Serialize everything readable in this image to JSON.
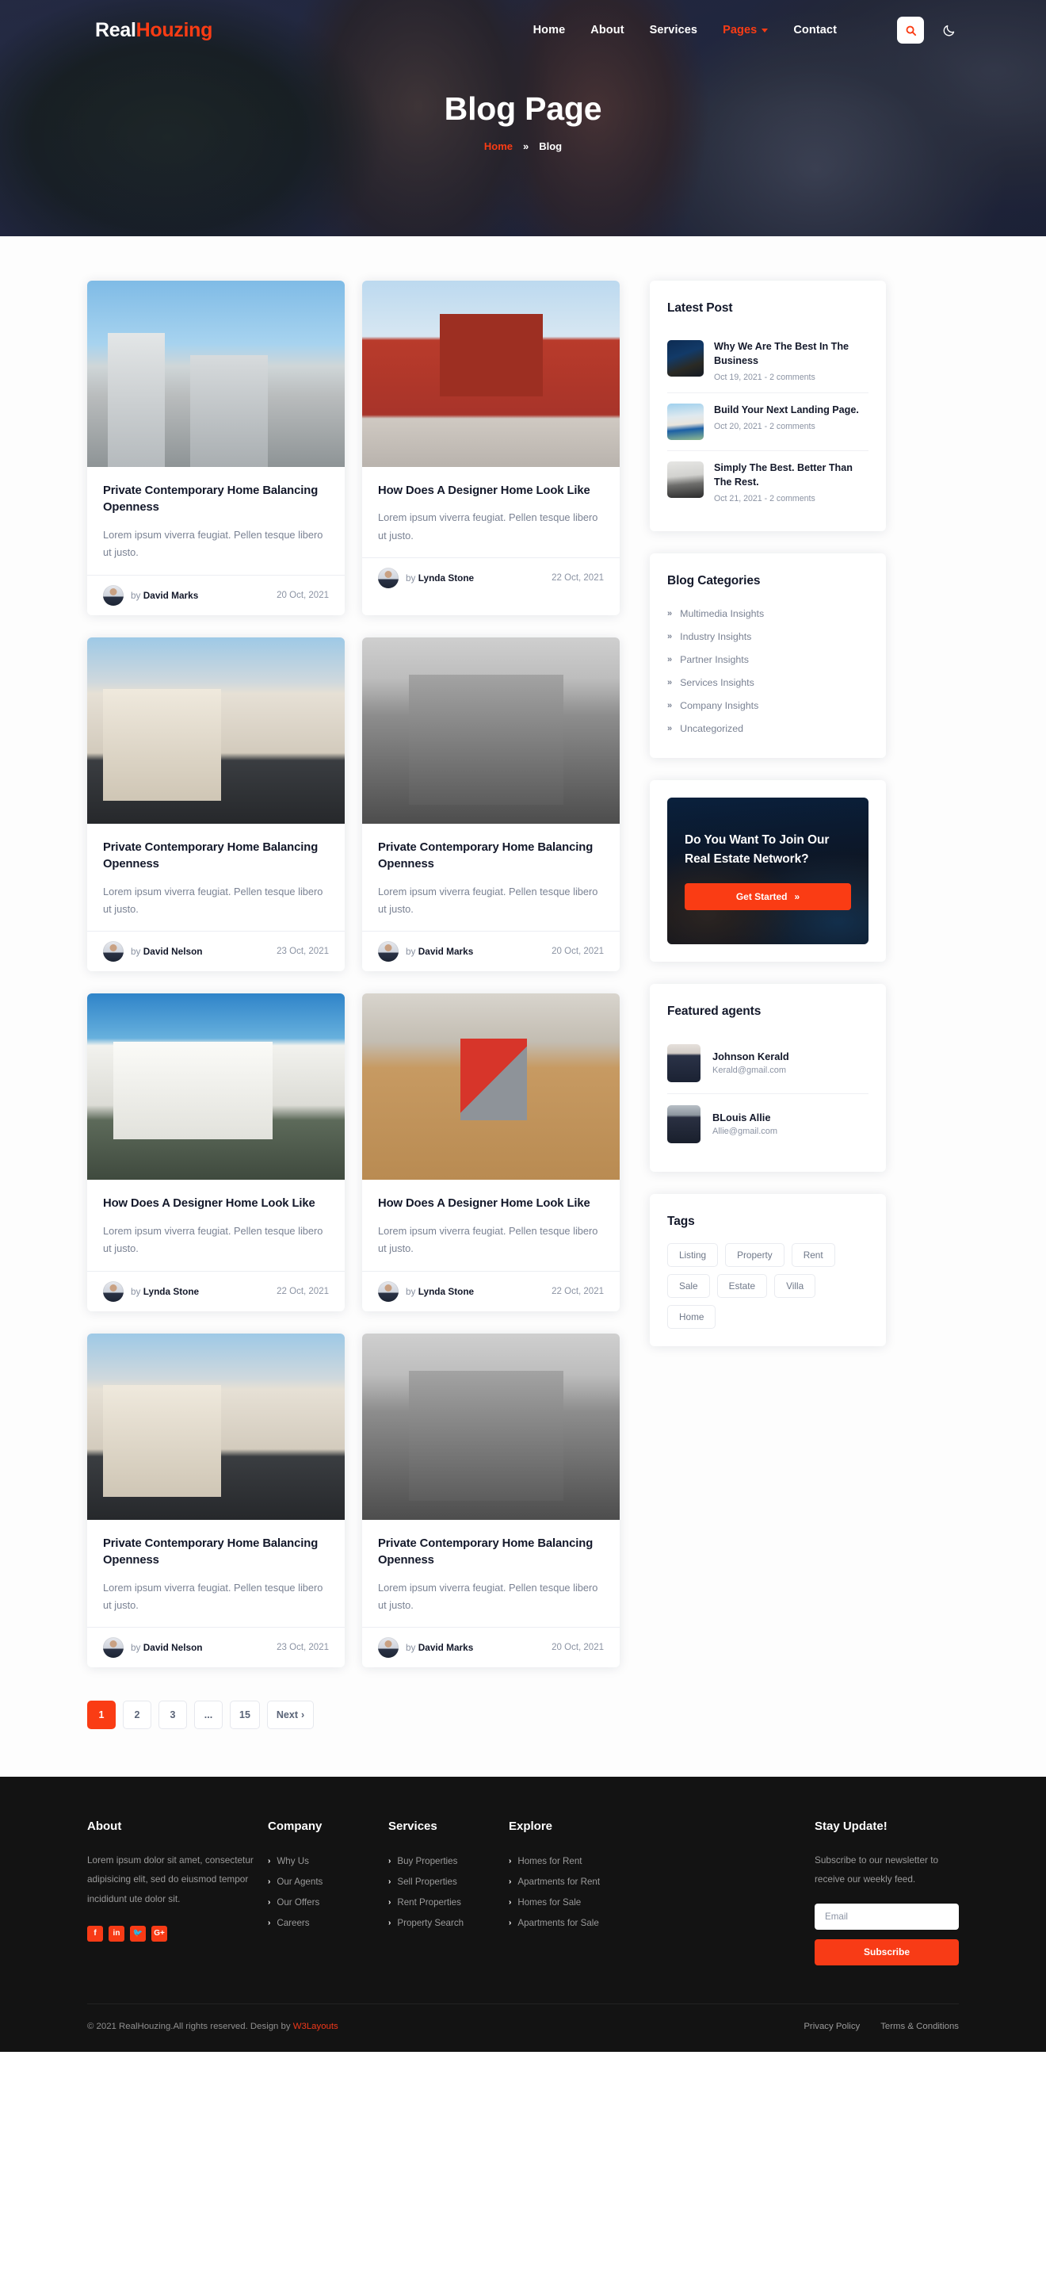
{
  "brand": {
    "part1": "Real",
    "part2": "Houzing"
  },
  "nav": {
    "links": [
      {
        "label": "Home",
        "active": false
      },
      {
        "label": "About",
        "active": false
      },
      {
        "label": "Services",
        "active": false
      },
      {
        "label": "Pages",
        "active": true
      },
      {
        "label": "Contact",
        "active": false
      }
    ],
    "search_icon": "search-icon",
    "theme_icon": "moon-icon"
  },
  "hero": {
    "title": "Blog Page",
    "breadcrumb_home": "Home",
    "breadcrumb_sep": "»",
    "breadcrumb_current": "Blog"
  },
  "posts": [
    {
      "title": "Private Contemporary Home Balancing Openness",
      "excerpt": "Lorem ipsum viverra feugiat. Pellen tesque libero ut justo.",
      "by": "by",
      "author": "David Marks",
      "date": "20 Oct, 2021",
      "img": "im-city1"
    },
    {
      "title": "How Does A Designer Home Look Like",
      "excerpt": "Lorem ipsum viverra feugiat. Pellen tesque libero ut justo.",
      "by": "by",
      "author": "Lynda Stone",
      "date": "22 Oct, 2021",
      "img": "im-red"
    },
    {
      "title": "Private Contemporary Home Balancing Openness",
      "excerpt": "Lorem ipsum viverra feugiat. Pellen tesque libero ut justo.",
      "by": "by",
      "author": "David Nelson",
      "date": "23 Oct, 2021",
      "img": "im-beige"
    },
    {
      "title": "Private Contemporary Home Balancing Openness",
      "excerpt": "Lorem ipsum viverra feugiat. Pellen tesque libero ut justo.",
      "by": "by",
      "author": "David Marks",
      "date": "20 Oct, 2021",
      "img": "im-gray"
    },
    {
      "title": "How Does A Designer Home Look Like",
      "excerpt": "Lorem ipsum viverra feugiat. Pellen tesque libero ut justo.",
      "by": "by",
      "author": "Lynda Stone",
      "date": "22 Oct, 2021",
      "img": "im-white"
    },
    {
      "title": "How Does A Designer Home Look Like",
      "excerpt": "Lorem ipsum viverra feugiat. Pellen tesque libero ut justo.",
      "by": "by",
      "author": "Lynda Stone",
      "date": "22 Oct, 2021",
      "img": "im-key"
    },
    {
      "title": "Private Contemporary Home Balancing Openness",
      "excerpt": "Lorem ipsum viverra feugiat. Pellen tesque libero ut justo.",
      "by": "by",
      "author": "David Nelson",
      "date": "23 Oct, 2021",
      "img": "im-beige"
    },
    {
      "title": "Private Contemporary Home Balancing Openness",
      "excerpt": "Lorem ipsum viverra feugiat. Pellen tesque libero ut justo.",
      "by": "by",
      "author": "David Marks",
      "date": "20 Oct, 2021",
      "img": "im-gray"
    }
  ],
  "pagination": {
    "items": [
      "1",
      "2",
      "3",
      "...",
      "15"
    ],
    "active_index": 0,
    "next_label": "Next",
    "next_icon": "chevron-right-icon"
  },
  "sidebar": {
    "latest_post": {
      "title": "Latest Post",
      "items": [
        {
          "title": "Why We Are The Best In The Business",
          "meta": "Oct 19, 2021 - 2 comments",
          "img": "im-lp1"
        },
        {
          "title": "Build Your Next Landing Page.",
          "meta": "Oct 20, 2021 - 2 comments",
          "img": "im-lp2"
        },
        {
          "title": "Simply The Best. Better Than The Rest.",
          "meta": "Oct 21, 2021 - 2 comments",
          "img": "im-lp3"
        }
      ]
    },
    "categories": {
      "title": "Blog Categories",
      "items": [
        "Multimedia Insights",
        "Industry Insights",
        "Partner Insights",
        "Services Insights",
        "Company Insights",
        "Uncategorized"
      ]
    },
    "cta": {
      "title": "Do You Want To Join Our Real Estate Network?",
      "button": "Get Started",
      "button_icon": "double-chevron-right-icon"
    },
    "agents": {
      "title": "Featured agents",
      "items": [
        {
          "name": "Johnson Kerald",
          "email": "Kerald@gmail.com",
          "img": "im-ag1"
        },
        {
          "name": "BLouis Allie",
          "email": "Allie@gmail.com",
          "img": "im-ag2"
        }
      ]
    },
    "tags": {
      "title": "Tags",
      "items": [
        "Listing",
        "Property",
        "Rent",
        "Sale",
        "Estate",
        "Villa",
        "Home"
      ]
    }
  },
  "footer": {
    "about": {
      "head": "About",
      "text": "Lorem ipsum dolor sit amet, consectetur adipisicing elit, sed do eiusmod tempor incididunt ute dolor sit.",
      "socials": [
        {
          "name": "facebook-icon",
          "glyph": "f"
        },
        {
          "name": "linkedin-icon",
          "glyph": "in"
        },
        {
          "name": "twitter-icon",
          "glyph": "🐦"
        },
        {
          "name": "google-plus-icon",
          "glyph": "G+"
        }
      ]
    },
    "company": {
      "head": "Company",
      "links": [
        "Why Us",
        "Our Agents",
        "Our Offers",
        "Careers"
      ]
    },
    "services": {
      "head": "Services",
      "links": [
        "Buy Properties",
        "Sell Properties",
        "Rent Properties",
        "Property Search"
      ]
    },
    "explore": {
      "head": "Explore",
      "links": [
        "Homes for Rent",
        "Apartments for Rent",
        "Homes for Sale",
        "Apartments for Sale"
      ]
    },
    "newsletter": {
      "head": "Stay Update!",
      "text": "Subscribe to our newsletter to receive our weekly feed.",
      "placeholder": "Email",
      "value": "",
      "button": "Subscribe"
    },
    "bottom": {
      "copy_pre": "© 2021 RealHouzing.All rights reserved. Design by ",
      "copy_brand": "W3Layouts",
      "legal": [
        "Privacy Policy",
        "Terms & Conditions"
      ]
    }
  },
  "colors": {
    "accent": "#fa3c14",
    "dark": "#131313",
    "heading": "#13182a",
    "muted": "#7a8293"
  }
}
